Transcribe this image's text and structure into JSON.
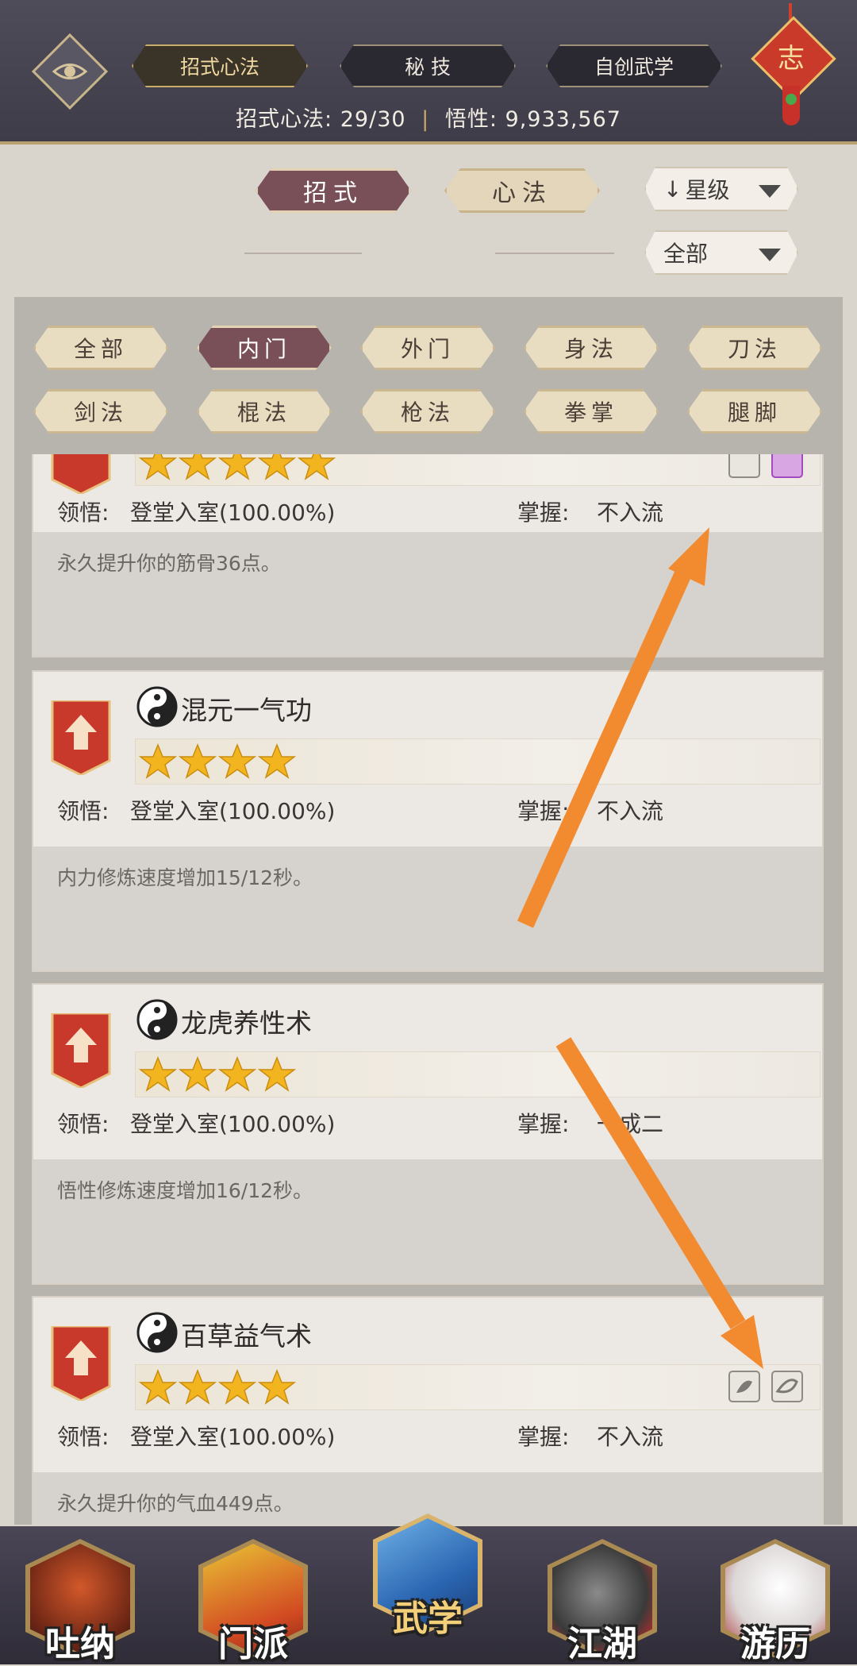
{
  "top_tabs": [
    {
      "label": "招式心法",
      "active": true
    },
    {
      "label": "秘 技",
      "active": false
    },
    {
      "label": "自创武学",
      "active": false
    }
  ],
  "top_stats": {
    "moves_label": "招式心法:",
    "moves_value": "29/30",
    "insight_label": "悟性:",
    "insight_value": "9,933,567"
  },
  "knot_char": "志",
  "mode_tabs": [
    {
      "label": "招式",
      "active": true
    },
    {
      "label": "心法",
      "active": false
    }
  ],
  "sort_dropdown": {
    "label": "星级",
    "arrow": "↓"
  },
  "filter_dropdown": {
    "label": "全部"
  },
  "categories": [
    {
      "label": "全部",
      "active": false
    },
    {
      "label": "内门",
      "active": true
    },
    {
      "label": "外门",
      "active": false
    },
    {
      "label": "身法",
      "active": false
    },
    {
      "label": "刀法",
      "active": false
    },
    {
      "label": "剑法",
      "active": false
    },
    {
      "label": "棍法",
      "active": false
    },
    {
      "label": "枪法",
      "active": false
    },
    {
      "label": "拳掌",
      "active": false
    },
    {
      "label": "腿脚",
      "active": false
    }
  ],
  "skills": [
    {
      "name": "",
      "stars": 5,
      "comprehension_label": "领悟:",
      "comprehension": "登堂入室(100.00%)",
      "mastery_label": "掌握:",
      "mastery": "不入流",
      "description": "永久提升你的筋骨36点。"
    },
    {
      "name": "混元一气功",
      "stars": 4,
      "comprehension_label": "领悟:",
      "comprehension": "登堂入室(100.00%)",
      "mastery_label": "掌握:",
      "mastery": "不入流",
      "description": "内力修炼速度增加15/12秒。"
    },
    {
      "name": "龙虎养性术",
      "stars": 4,
      "comprehension_label": "领悟:",
      "comprehension": "登堂入室(100.00%)",
      "mastery_label": "掌握:",
      "mastery": "一成二",
      "description": "悟性修炼速度增加16/12秒。"
    },
    {
      "name": "百草益气术",
      "stars": 4,
      "comprehension_label": "领悟:",
      "comprehension": "登堂入室(100.00%)",
      "mastery_label": "掌握:",
      "mastery": "不入流",
      "description": "永久提升你的气血449点。"
    }
  ],
  "nav": [
    {
      "label": "吐纳",
      "icon": "meditating-monk-icon",
      "active": false
    },
    {
      "label": "门派",
      "icon": "sect-banner-icon",
      "active": false
    },
    {
      "label": "武学",
      "icon": "martial-book-icon",
      "active": true
    },
    {
      "label": "江湖",
      "icon": "bamboo-hat-icon",
      "active": false
    },
    {
      "label": "游历",
      "icon": "white-horse-icon",
      "active": false
    }
  ],
  "colors": {
    "accent_active": "#7a5058",
    "annotation_arrow": "#f28a30",
    "topbar": "#4a4754"
  }
}
